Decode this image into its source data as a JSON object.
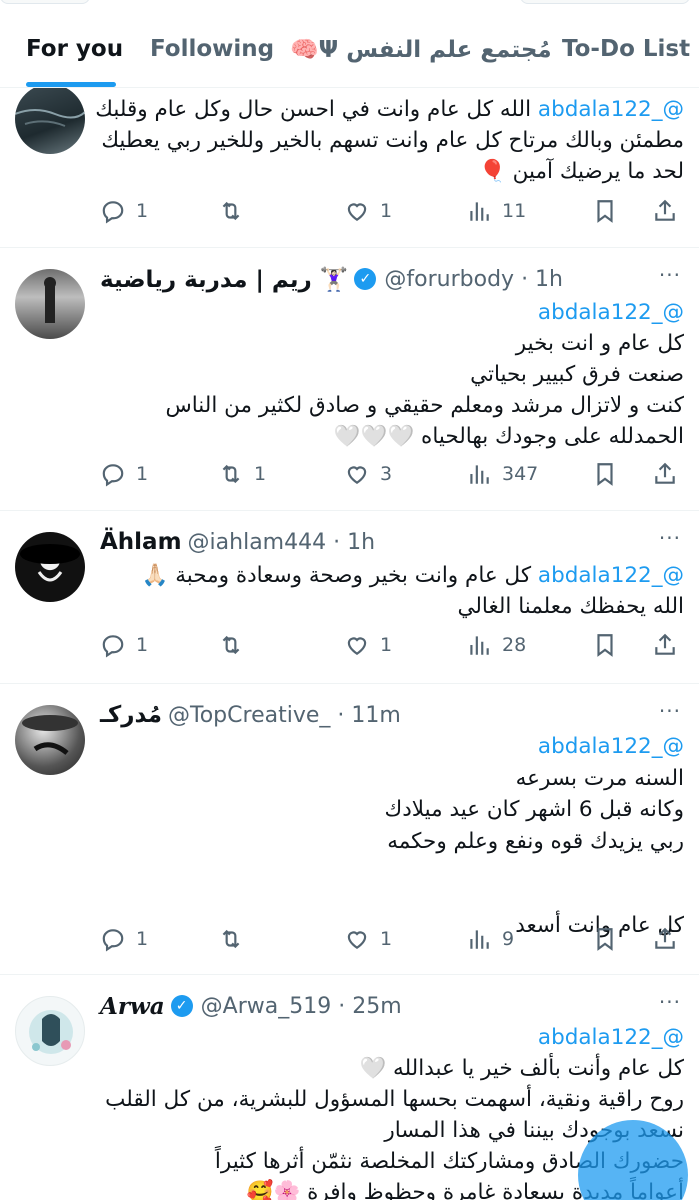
{
  "tabs": [
    {
      "label": "For you",
      "active": true
    },
    {
      "label": "Following",
      "active": false
    },
    {
      "label": "مُجتمع علم النفس",
      "prefix_emoji": "🧠Ψ",
      "active": false
    },
    {
      "label": "To-Do List",
      "active": false
    }
  ],
  "tweets": [
    {
      "name": "",
      "handle": "",
      "time": "",
      "body": [
        {
          "mention": "@_abdala122",
          "text": " الله كل عام وانت في احسن حال وكل عام وقلبك"
        },
        {
          "text": "مطمئن وبالك مرتاح كل عام وانت تسهم بالخير وللخير ربي يعطيك"
        },
        {
          "text": "لحد ما يرضيك آمين 🎈"
        }
      ],
      "replies": "1",
      "retweets": "",
      "likes": "1",
      "views": "11"
    },
    {
      "name": "ريم | مدربة رياضية 🏋🏻‍♀️",
      "verified": true,
      "handle": "@forurbody · 1h",
      "body": [
        {
          "mention": "@_abdala122",
          "text": ""
        },
        {
          "text": "كل عام و انت بخير"
        },
        {
          "text": "صنعت فرق كبيير بحياتي"
        },
        {
          "text": "كنت و لاتزال مرشد ومعلم حقيقي و صادق لكثير من الناس"
        },
        {
          "text": "الحمدلله على وجودك بهالحياه 🤍🤍🤍"
        }
      ],
      "replies": "1",
      "retweets": "1",
      "likes": "3",
      "views": "347"
    },
    {
      "name": "Ählam",
      "verified": false,
      "handle": "@iahlam444 · 1h",
      "body": [
        {
          "mention": "@_abdala122",
          "text": " كل عام وانت بخير وصحة وسعادة ومحبة 🙏🏻"
        },
        {
          "text": "الله يحفظك معلمنا الغالي"
        }
      ],
      "replies": "1",
      "retweets": "",
      "likes": "1",
      "views": "28"
    },
    {
      "name": "مُدركـ",
      "verified": false,
      "handle": "@TopCreative_ · 11m",
      "body": [
        {
          "mention": "@_abdala122",
          "text": ""
        },
        {
          "text": "السنه مرت بسرعه"
        },
        {
          "text": "وكانه قبل 6 اشهر كان عيد ميلادك"
        },
        {
          "text": "ربي يزيدك قوه ونفع وعلم وحكمه"
        },
        {
          "text": ""
        },
        {
          "text": "كل عام وانت أسعد"
        }
      ],
      "replies": "1",
      "retweets": "",
      "likes": "1",
      "views": "9"
    },
    {
      "name": "Arwa",
      "verified": true,
      "handle": "@Arwa_519 · 25m",
      "body": [
        {
          "mention": "@_abdala122",
          "text": ""
        },
        {
          "text": "كل عام وأنت بألف خير يا عبدالله 🤍"
        },
        {
          "text": "روح راقية ونقية، أسهمت بحسها المسؤول للبشرية، من كل القلب"
        },
        {
          "text": "نسعد بوجودك بيننا في هذا المسار"
        },
        {
          "text": "حضورك الصادق ومشاركتك المخلصة نثمّن أثرها كثيراً"
        },
        {
          "text": "أعواماً مديدة بسعادة غامرة وحظوظ وافرة 🌸🥰"
        }
      ],
      "replies": "",
      "retweets": "",
      "likes": "",
      "views": ""
    }
  ],
  "more_glyph": "···",
  "colors": {
    "accent": "#1d9bf0",
    "text": "#0f1419",
    "muted": "#536471",
    "divider": "#eff3f4"
  }
}
